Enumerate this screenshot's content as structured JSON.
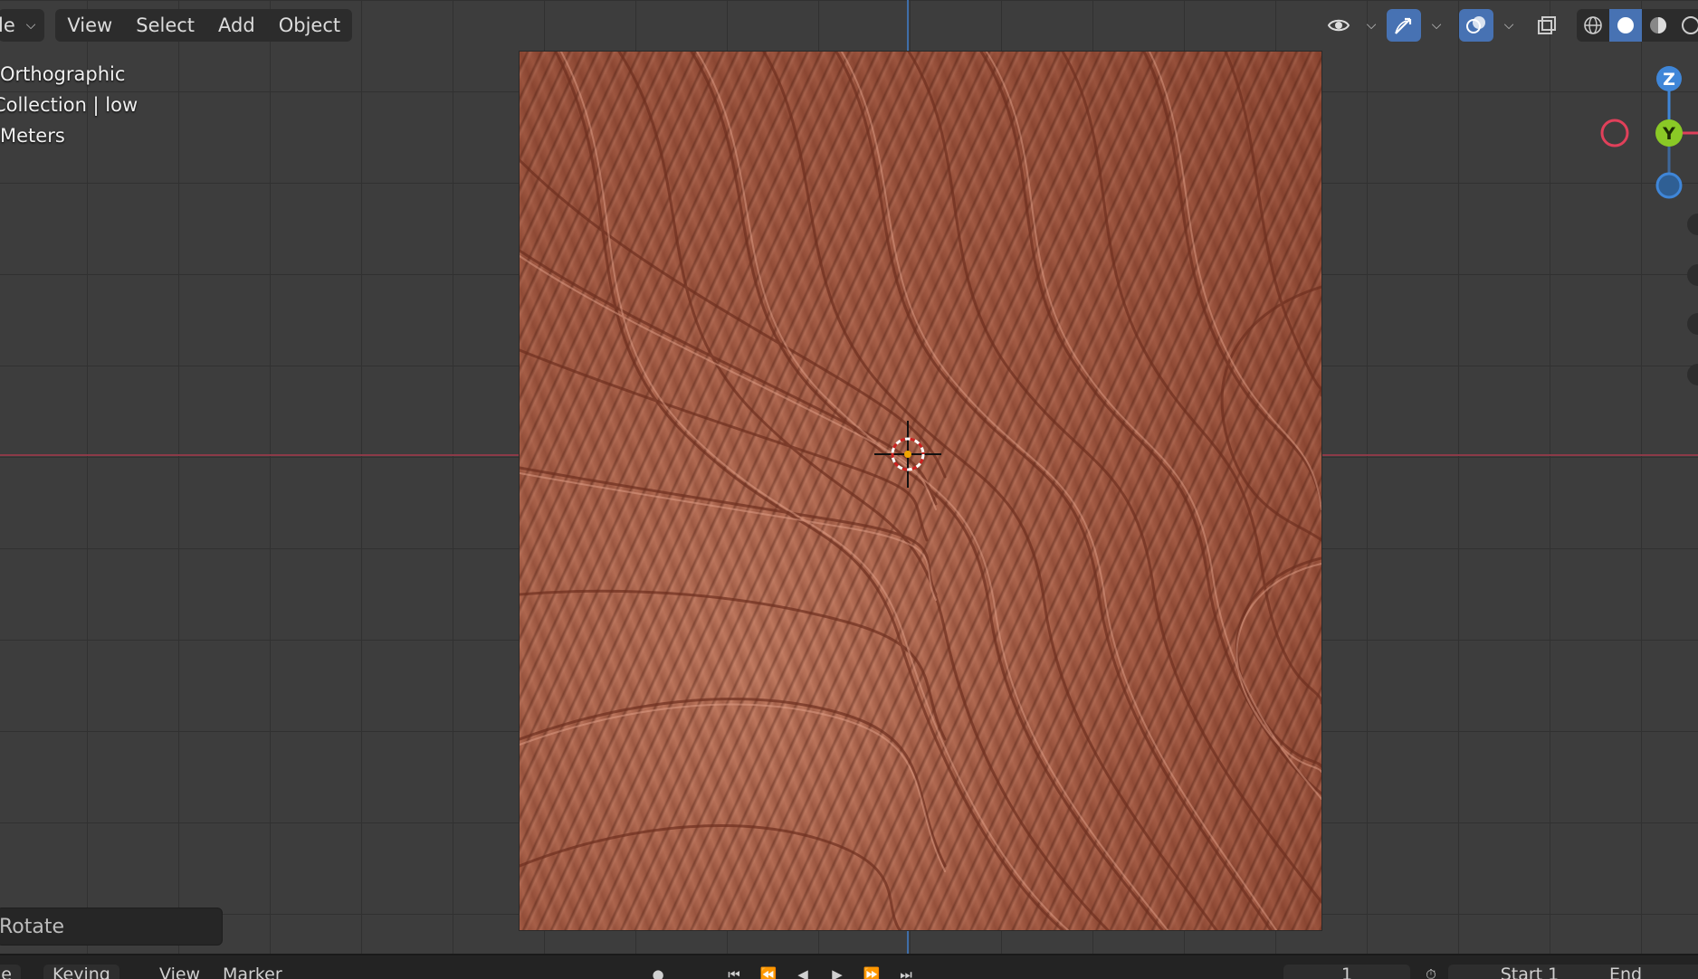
{
  "header": {
    "mode_label": "le",
    "menu": {
      "view": "View",
      "select": "Select",
      "add": "Add",
      "object": "Object"
    }
  },
  "overlay": {
    "projection": "Orthographic",
    "collection": "Collection | low",
    "units": "Meters"
  },
  "gizmo": {
    "z_label": "Z",
    "y_label": "Y",
    "colors": {
      "x": "#e0405a",
      "y": "#8ac926",
      "z": "#3f86d8"
    }
  },
  "operator_panel": {
    "label": "Rotate"
  },
  "timeline": {
    "items": [
      "le",
      "Keying",
      "View",
      "Marker"
    ],
    "frame": "1",
    "start": "Start 1",
    "end": "End"
  },
  "icons": {
    "visibility": "eye-icon",
    "gizmo": "gizmo-icon",
    "overlay": "overlay-icon",
    "xray": "xray-icon",
    "shading": [
      "wireframe-icon",
      "solid-icon",
      "material-icon",
      "rendered-icon"
    ]
  },
  "colors": {
    "accent": "#4772b3",
    "x_axis": "#8c3a48",
    "y_axis": "#3f6ea8",
    "mesh": "#a45c45"
  }
}
